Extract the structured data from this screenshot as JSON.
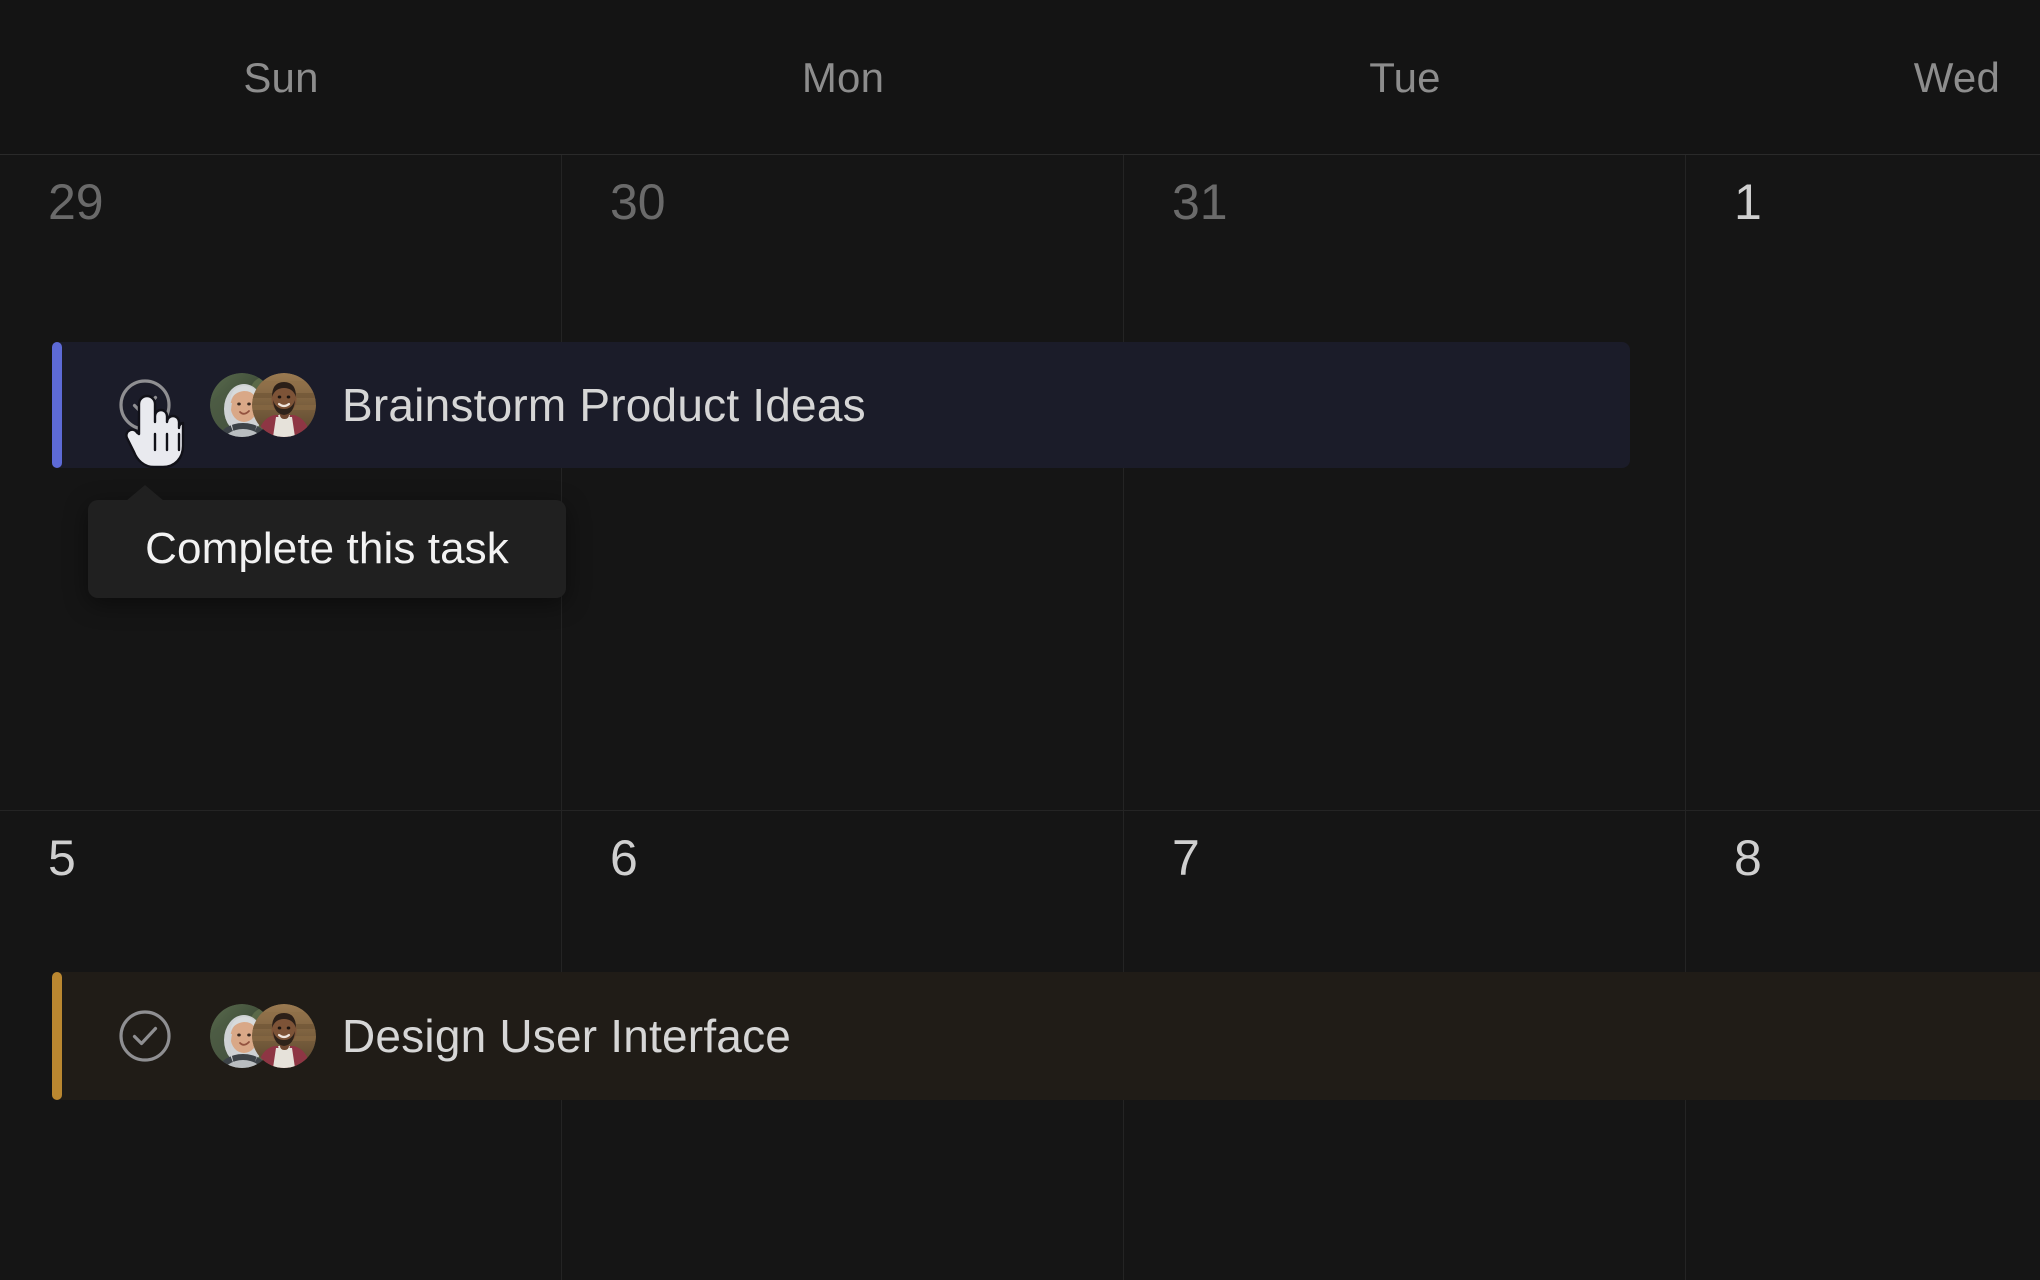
{
  "header": {
    "weekdays": [
      {
        "label": "Sun"
      },
      {
        "label": "Mon"
      },
      {
        "label": "Tue"
      },
      {
        "label": "Wed"
      }
    ]
  },
  "weeks": [
    {
      "days": [
        {
          "number": "29",
          "current_month": false
        },
        {
          "number": "30",
          "current_month": false
        },
        {
          "number": "31",
          "current_month": false
        },
        {
          "number": "1",
          "current_month": true
        }
      ]
    },
    {
      "days": [
        {
          "number": "5",
          "current_month": true
        },
        {
          "number": "6",
          "current_month": true
        },
        {
          "number": "7",
          "current_month": true
        },
        {
          "number": "8",
          "current_month": true
        }
      ]
    }
  ],
  "tasks": [
    {
      "title": "Brainstorm Product Ideas",
      "accent_color": "#5d6ad6",
      "background_color": "#1b1c29",
      "complete_icon": "circle-check-icon",
      "assignees": [
        {
          "name": "assignee-avatar-1"
        },
        {
          "name": "assignee-avatar-2"
        }
      ]
    },
    {
      "title": "Design User Interface",
      "accent_color": "#ba8730",
      "background_color": "#201c17",
      "complete_icon": "circle-check-icon",
      "assignees": [
        {
          "name": "assignee-avatar-1"
        },
        {
          "name": "assignee-avatar-2"
        }
      ]
    }
  ],
  "tooltip": {
    "label": "Complete this task"
  },
  "cursor": {
    "type": "pointer-hand-cursor"
  },
  "colors": {
    "page_background": "#121212",
    "cell_background": "#151515",
    "header_background": "#141414",
    "grid_line": "#242424",
    "weekday_text": "#8d8d8d",
    "day_dim_text": "#6a6a6a",
    "day_bright_text": "#cfcfcf",
    "task_title_text": "#d6d6d6",
    "tooltip_background": "#202020",
    "tooltip_text": "#f2f2f2",
    "accent_blue": "#5d6ad6",
    "accent_amber": "#ba8730"
  }
}
